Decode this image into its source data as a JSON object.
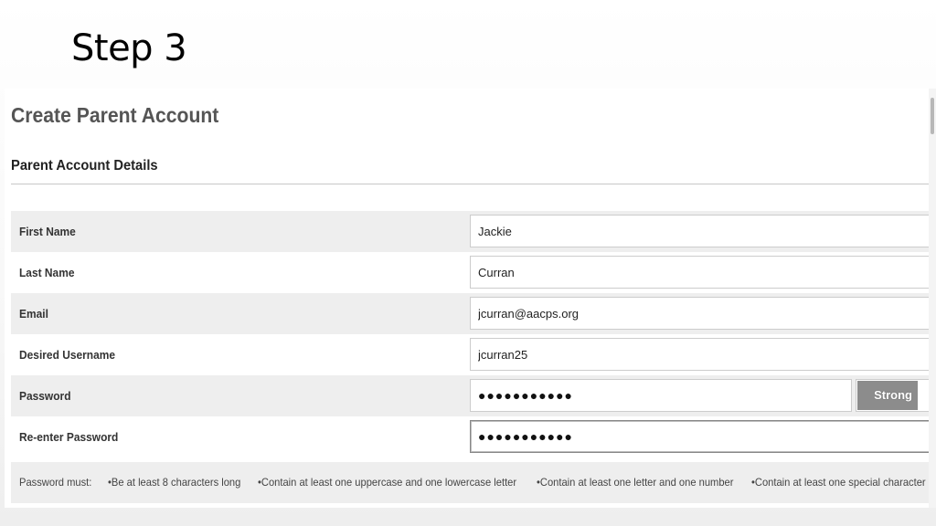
{
  "slide": {
    "title": "Step 3"
  },
  "form": {
    "page_heading": "Create Parent Account",
    "section_heading": "Parent Account Details",
    "fields": [
      {
        "label": "First Name",
        "value": "Jackie"
      },
      {
        "label": "Last Name",
        "value": "Curran"
      },
      {
        "label": "Email",
        "value": "jcurran@aacps.org"
      },
      {
        "label": "Desired Username",
        "value": "jcurran25"
      },
      {
        "label": "Password",
        "value": "●●●●●●●●●●●"
      },
      {
        "label": "Re-enter Password",
        "value": "●●●●●●●●●●●"
      }
    ],
    "password_strength": {
      "label": "Strong",
      "level": 0.8,
      "bar_color": "#8c8c8c"
    },
    "rules": {
      "prefix": "Password must:",
      "items": [
        "•Be at least 8 characters long",
        "•Contain at least one uppercase and one lowercase letter",
        "•Contain at least one letter and one number",
        "•Contain at least one special character"
      ]
    }
  }
}
